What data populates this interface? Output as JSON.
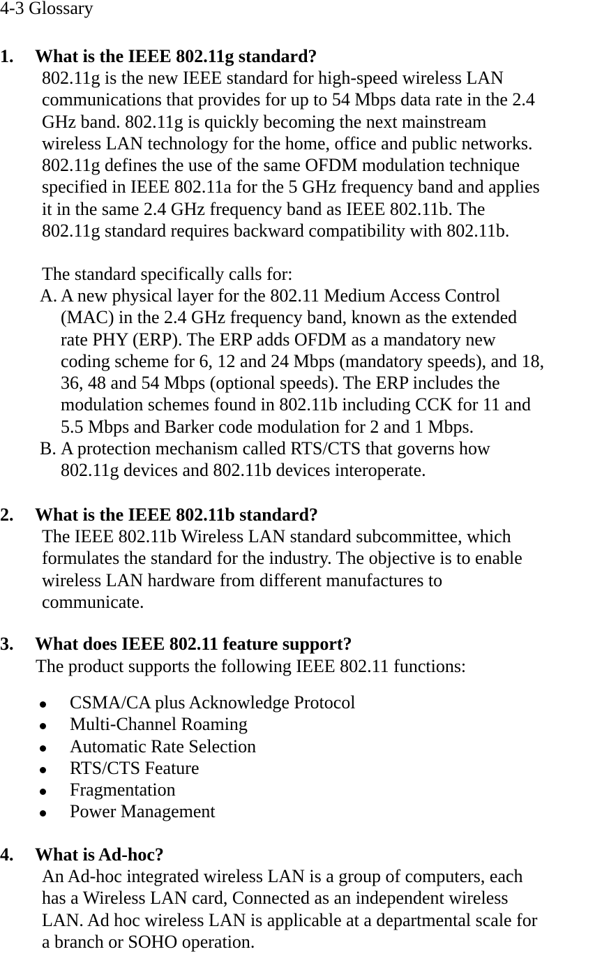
{
  "title": "4-3 Glossary",
  "sections": [
    {
      "number": "1.",
      "question": "What is the IEEE 802.11g standard?",
      "paragraph_lines": [
        "802.11g is the new IEEE standard for high-speed wireless LAN",
        "communications that provides for up to 54 Mbps data rate in the 2.4",
        "GHz band. 802.11g is quickly becoming the next mainstream",
        "wireless LAN technology for the home, office and public networks.",
        "802.11g defines the use of the same OFDM modulation technique",
        "specified in IEEE 802.11a for the 5 GHz frequency band and applies",
        "it in the same 2.4 GHz frequency band as IEEE 802.11b. The",
        "802.11g standard requires backward compatibility with 802.11b."
      ],
      "intro": "The standard specifically calls for:",
      "items": [
        {
          "label": "A.",
          "lines": [
            "A new physical layer for the 802.11 Medium Access Control",
            "(MAC) in the 2.4 GHz frequency band, known as the extended",
            "rate PHY (ERP). The ERP adds OFDM as a mandatory new",
            "coding scheme for 6, 12 and 24 Mbps (mandatory speeds), and 18,",
            "36, 48 and 54 Mbps (optional speeds). The ERP includes the",
            "modulation schemes found in 802.11b including CCK for 11 and",
            "5.5 Mbps and Barker code modulation for 2 and 1 Mbps."
          ]
        },
        {
          "label": "B.",
          "lines": [
            "A protection mechanism called RTS/CTS that governs how",
            "802.11g devices and 802.11b devices interoperate."
          ]
        }
      ]
    },
    {
      "number": "2.",
      "question": "What is the IEEE 802.11b standard?",
      "paragraph_lines": [
        "The IEEE 802.11b Wireless LAN standard subcommittee, which",
        "formulates the standard for the industry. The objective is to enable",
        "wireless LAN hardware from different manufactures to",
        "communicate."
      ]
    },
    {
      "number": "3.",
      "question": "What does IEEE 802.11 feature support?",
      "intro": "The product supports the following IEEE 802.11 functions:",
      "bullets": [
        "CSMA/CA plus Acknowledge Protocol",
        "Multi-Channel Roaming",
        "Automatic Rate Selection",
        "RTS/CTS Feature",
        "Fragmentation",
        "Power Management"
      ]
    },
    {
      "number": "4.",
      "question": "What is Ad-hoc?",
      "paragraph_lines": [
        "An Ad-hoc integrated wireless LAN is a group of computers, each",
        "has a Wireless LAN card, Connected as an independent wireless",
        "LAN. Ad hoc wireless LAN is applicable at a departmental scale for",
        "a branch or SOHO operation."
      ]
    }
  ]
}
